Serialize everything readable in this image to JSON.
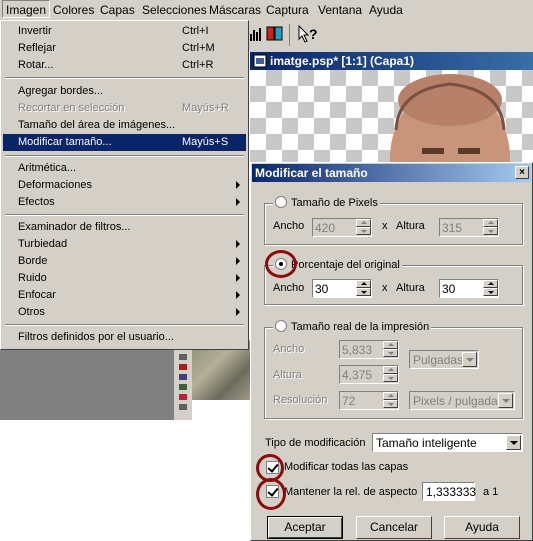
{
  "menubar": {
    "items": [
      "Imagen",
      "Colores",
      "Capas",
      "Selecciones",
      "Máscaras",
      "Captura",
      "Ventana",
      "Ayuda"
    ]
  },
  "dropdown": {
    "items": [
      {
        "label": "Invertir",
        "shortcut": "Ctrl+I"
      },
      {
        "label": "Reflejar",
        "shortcut": "Ctrl+M"
      },
      {
        "label": "Rotar...",
        "shortcut": "Ctrl+R"
      },
      {
        "label": "Agregar bordes..."
      },
      {
        "label": "Recortar en selección",
        "shortcut": "Mayús+R",
        "disabled": true
      },
      {
        "label": "Tamaño del área de imágenes..."
      },
      {
        "label": "Modificar tamaño...",
        "shortcut": "Mayús+S",
        "selected": true
      },
      {
        "label": "Aritmética..."
      },
      {
        "label": "Deformaciones",
        "submenu": true
      },
      {
        "label": "Efectos",
        "submenu": true
      },
      {
        "label": "Examinador de filtros..."
      },
      {
        "label": "Turbiedad",
        "submenu": true
      },
      {
        "label": "Borde",
        "submenu": true
      },
      {
        "label": "Ruido",
        "submenu": true
      },
      {
        "label": "Enfocar",
        "submenu": true
      },
      {
        "label": "Otros",
        "submenu": true
      },
      {
        "label": "Filtros definidos por el usuario..."
      }
    ]
  },
  "image_window": {
    "title": "imatge.psp* [1:1] (Capa1)"
  },
  "dialog": {
    "title": "Modificar el tamaño",
    "close": "×",
    "pixels": {
      "label": "Tamaño de Pixels",
      "width_label": "Ancho",
      "width": "420",
      "x": "x",
      "height_label": "Altura",
      "height": "315"
    },
    "percent": {
      "label": "Porcentaje del original",
      "width_label": "Ancho",
      "width": "30",
      "x": "x",
      "height_label": "Altura",
      "height": "30"
    },
    "print": {
      "label": "Tamaño real de la impresión",
      "width_label": "Ancho",
      "width": "5,833",
      "height_label": "Altura",
      "height": "4,375",
      "resolution_label": "Resolución",
      "resolution": "72",
      "unit": "Pulgadas",
      "res_unit": "Pixels / pulgada"
    },
    "mod_type_label": "Tipo de modificación",
    "mod_type": "Tamaño inteligente",
    "all_layers_label": "Modificar todas las capas",
    "aspect_label": "Mantener la rel. de aspecto",
    "aspect_value": "1,333333",
    "aspect_suffix": "a 1",
    "buttons": {
      "ok": "Aceptar",
      "cancel": "Cancelar",
      "help": "Ayuda"
    }
  },
  "colors": {
    "menu_bg": "#d4d0c8",
    "selection": "#0a246a",
    "annotation_ring": "#8b0a0a"
  }
}
